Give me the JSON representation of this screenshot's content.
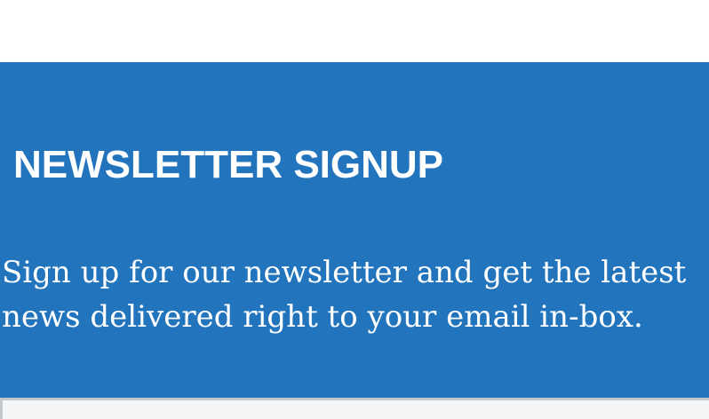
{
  "newsletter": {
    "title": "NEWSLETTER SIGNUP",
    "description_line_1": "Sign up for our newsletter and get the latest",
    "description_line_2": "news delivered right to your email in-box.",
    "email_input": {
      "value": "",
      "placeholder": ""
    }
  },
  "colors": {
    "panel_background": "#2274bd",
    "text": "#ffffff",
    "input_background": "#f4f5f7",
    "input_border": "#c3c6ca"
  }
}
